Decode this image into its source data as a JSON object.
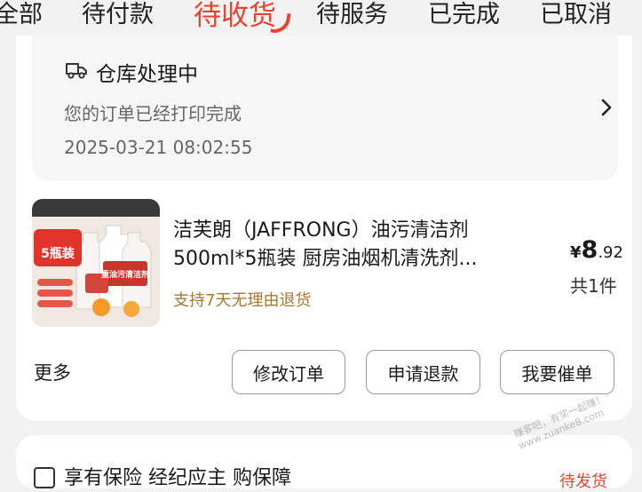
{
  "tabs": [
    {
      "label": "全部"
    },
    {
      "label": "待付款"
    },
    {
      "label": "待收货",
      "active": true
    },
    {
      "label": "待服务"
    },
    {
      "label": "已完成"
    },
    {
      "label": "已取消"
    }
  ],
  "order": {
    "logistics": {
      "icon": "truck-icon",
      "title": "仓库处理中",
      "description": "您的订单已经打印完成",
      "time": "2025-03-21 08:02:55"
    },
    "product": {
      "image_label": "5瓶装",
      "image_tag": "重油污清洁剂",
      "title_line1": "洁芙朗（JAFFRONG）油污清洁剂",
      "title_line2": "500ml*5瓶装 厨房油烟机清洗剂...",
      "return_policy": "支持7天无理由退货",
      "price_symbol": "¥",
      "price_int": "8",
      "price_dec": ".92",
      "quantity": "共1件"
    },
    "actions": {
      "more": "更多",
      "modify": "修改订单",
      "refund": "申请退款",
      "urge": "我要催单"
    }
  },
  "next_card": {
    "title": "享有保险 经纪应主 购保障",
    "right": "待发货"
  },
  "watermark": {
    "line1": "赚客吧，有奖一起赚！",
    "line2": "www.zuanke8.com"
  },
  "colors": {
    "accent": "#e8432f",
    "return_policy": "#a9772e",
    "background": "#f2f2f2"
  }
}
